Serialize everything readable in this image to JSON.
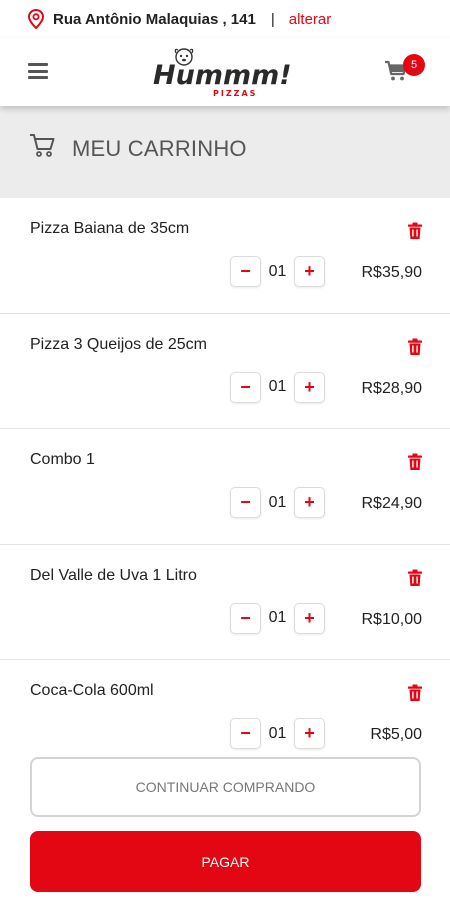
{
  "address": {
    "street": "Rua Antônio Malaquias , 141",
    "separator": "|",
    "change_label": "alterar"
  },
  "header": {
    "logo_text": "Hummm!",
    "logo_subtext": "PIZZAS",
    "cart_count": "5"
  },
  "page": {
    "title": "MEU CARRINHO"
  },
  "cart": {
    "items": [
      {
        "name": "Pizza Baiana de 35cm",
        "qty": "01",
        "price": "R$35,90"
      },
      {
        "name": "Pizza 3 Queijos de 25cm",
        "qty": "01",
        "price": "R$28,90"
      },
      {
        "name": "Combo 1",
        "qty": "01",
        "price": "R$24,90"
      },
      {
        "name": "Del Valle de Uva 1 Litro",
        "qty": "01",
        "price": "R$10,00"
      },
      {
        "name": "Coca-Cola 600ml",
        "qty": "01",
        "price": "R$5,00"
      }
    ],
    "minus_symbol": "−",
    "plus_symbol": "+"
  },
  "actions": {
    "continue_label": "CONTINUAR COMPRANDO",
    "pay_label": "PAGAR"
  },
  "colors": {
    "accent": "#e30613",
    "title_band": "#ececec"
  },
  "icons": [
    "location-pin-icon",
    "hamburger-menu-icon",
    "shopping-cart-icon",
    "trash-icon"
  ]
}
